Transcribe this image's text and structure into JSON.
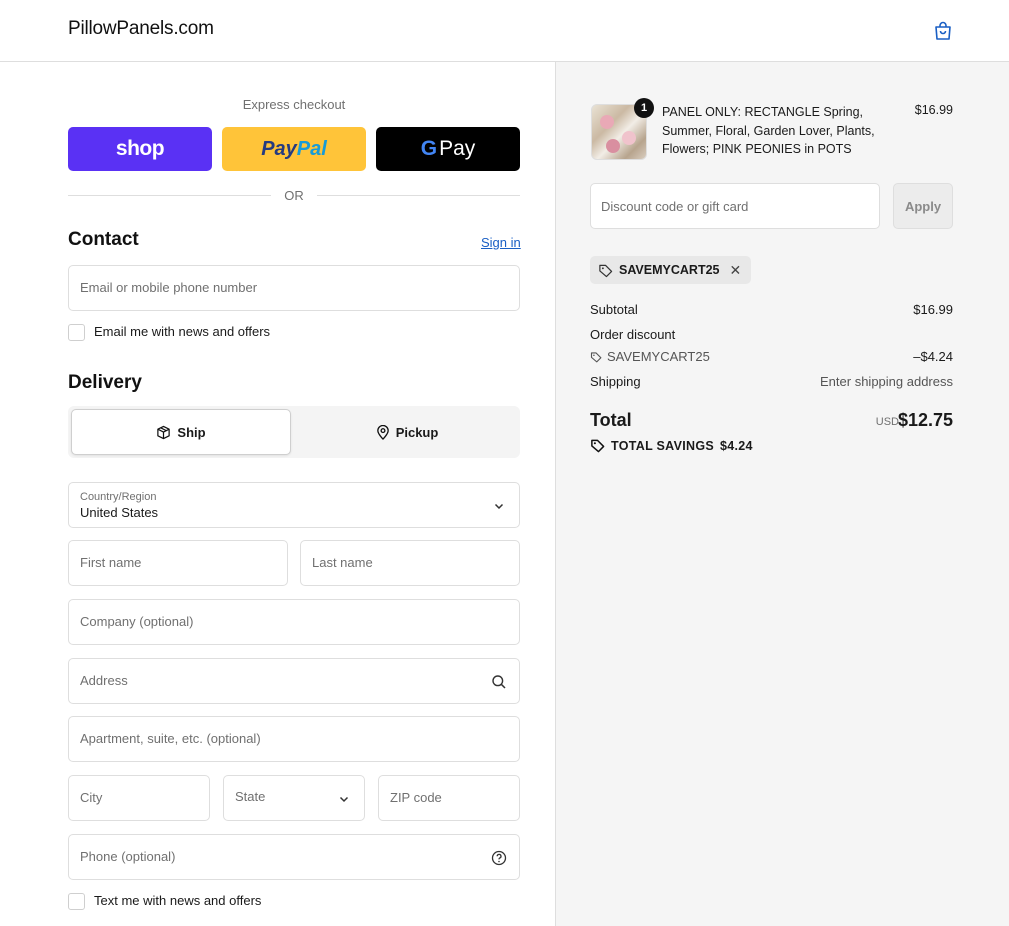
{
  "header": {
    "logo": "PillowPanels.com"
  },
  "express": {
    "label": "Express checkout",
    "shop_label": "shop",
    "paypal_label_1": "Pay",
    "paypal_label_2": "Pal",
    "gpay_label": "Pay",
    "or_label": "OR"
  },
  "contact": {
    "title": "Contact",
    "signin_label": "Sign in",
    "email_placeholder": "Email or mobile phone number",
    "news_label": "Email me with news and offers"
  },
  "delivery": {
    "title": "Delivery",
    "ship_label": "Ship",
    "pickup_label": "Pickup",
    "country_label": "Country/Region",
    "country_value": "United States",
    "first_name": "First name",
    "last_name": "Last name",
    "company": "Company (optional)",
    "address": "Address",
    "apartment": "Apartment, suite, etc. (optional)",
    "city": "City",
    "state": "State",
    "zip": "ZIP code",
    "phone": "Phone (optional)",
    "text_label": "Text me with news and offers"
  },
  "summary": {
    "quantity": "1",
    "product_name": "PANEL ONLY: RECTANGLE Spring, Summer, Floral, Garden Lover, Plants, Flowers; PINK PEONIES in POTS",
    "product_price": "$16.99",
    "discount_placeholder": "Discount code or gift card",
    "apply_label": "Apply",
    "code_chip": "SAVEMYCART25",
    "subtotal_label": "Subtotal",
    "subtotal_value": "$16.99",
    "order_discount_label": "Order discount",
    "discount_code": "SAVEMYCART25",
    "discount_value": "–$4.24",
    "shipping_label": "Shipping",
    "shipping_value": "Enter shipping address",
    "total_label": "Total",
    "currency": "USD",
    "total_value": "$12.75",
    "savings_label": "TOTAL SAVINGS",
    "savings_value": "$4.24"
  }
}
